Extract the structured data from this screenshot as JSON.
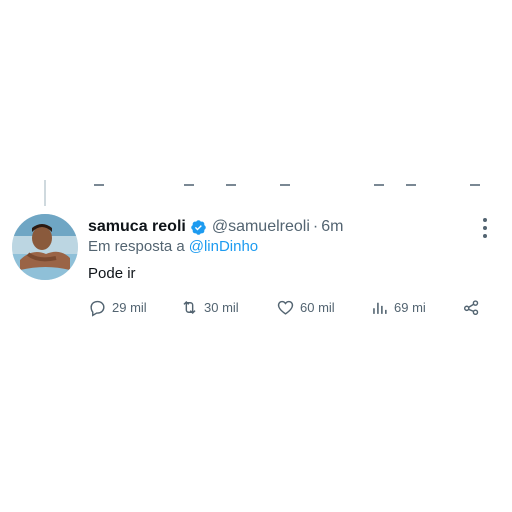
{
  "tweet": {
    "display_name": "samuca reoli",
    "verified": true,
    "handle": "@samuelreoli",
    "separator": "·",
    "time": "6m",
    "reply_prefix": "Em resposta a",
    "reply_mention": "@linDinho",
    "text": "Pode ir"
  },
  "actions": {
    "replies": "29 mil",
    "retweets": "30 mil",
    "likes": "60 mil",
    "views": "69 mi"
  },
  "colors": {
    "accent": "#1d9bf0",
    "secondary_text": "#536471",
    "primary_text": "#0f1419"
  }
}
